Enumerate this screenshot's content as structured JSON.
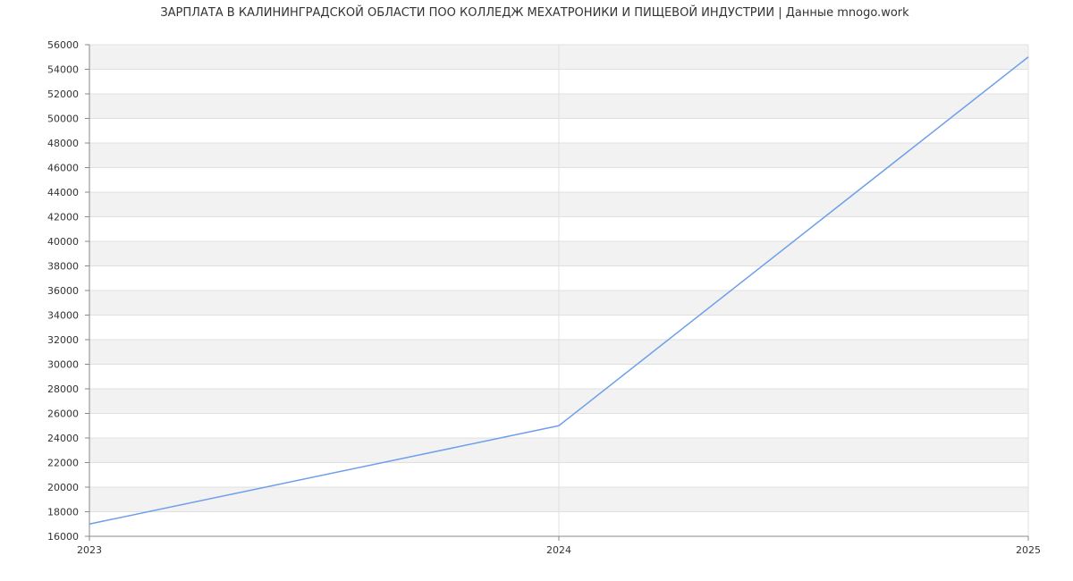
{
  "chart_data": {
    "type": "line",
    "title": "ЗАРПЛАТА В КАЛИНИНГРАДСКОЙ ОБЛАСТИ ПОО КОЛЛЕДЖ МЕХАТРОНИКИ И ПИЩЕВОЙ ИНДУСТРИИ | Данные mnogo.work",
    "xlabel": "",
    "ylabel": "",
    "x": [
      "2023",
      "2024",
      "2025"
    ],
    "series": [
      {
        "values": [
          17000,
          25000,
          55000
        ]
      }
    ],
    "ylim": [
      16000,
      56000
    ],
    "y_tick_step": 2000,
    "grid": true,
    "line_color": "#6d9eeb",
    "band_color": "#f2f2f2",
    "grid_color": "#e0e0e0",
    "axis_color": "#888888"
  }
}
